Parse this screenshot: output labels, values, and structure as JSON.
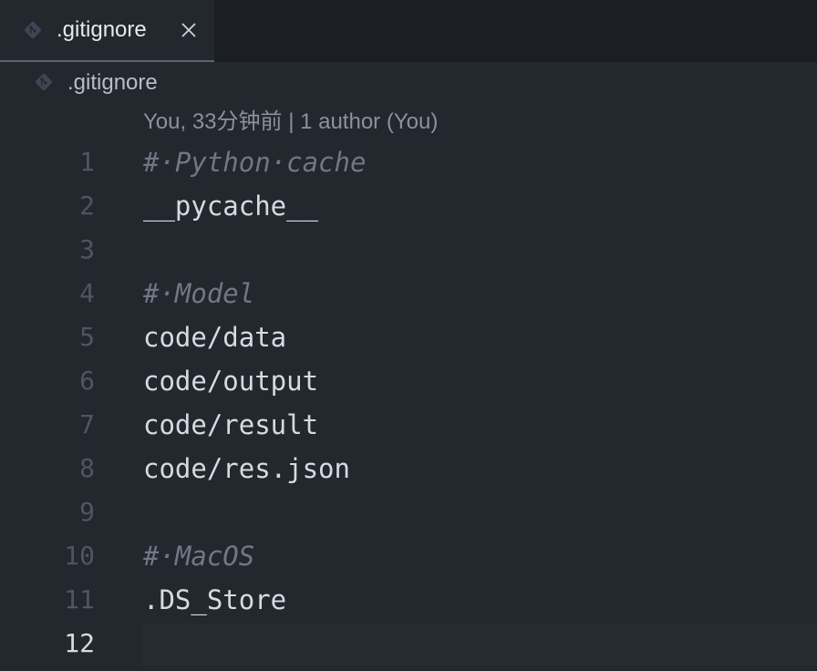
{
  "tab": {
    "label": ".gitignore",
    "icon": "git-diamond-icon",
    "close_icon": "close-icon",
    "close_symbol": "✕"
  },
  "breadcrumb": {
    "label": ".gitignore",
    "icon": "git-diamond-icon"
  },
  "blame": {
    "text": "You, 33分钟前 | 1 author (You)"
  },
  "editor": {
    "active_line": 12,
    "lines": [
      {
        "number": "1",
        "text": "#·Python·cache",
        "kind": "comment"
      },
      {
        "number": "2",
        "text": "__pycache__",
        "kind": "code"
      },
      {
        "number": "3",
        "text": "",
        "kind": "code"
      },
      {
        "number": "4",
        "text": "#·Model",
        "kind": "comment"
      },
      {
        "number": "5",
        "text": "code/data",
        "kind": "code"
      },
      {
        "number": "6",
        "text": "code/output",
        "kind": "code"
      },
      {
        "number": "7",
        "text": "code/result",
        "kind": "code"
      },
      {
        "number": "8",
        "text": "code/res.json",
        "kind": "code"
      },
      {
        "number": "9",
        "text": "",
        "kind": "code"
      },
      {
        "number": "10",
        "text": "#·MacOS",
        "kind": "comment"
      },
      {
        "number": "11",
        "text": ".DS_Store",
        "kind": "code"
      },
      {
        "number": "12",
        "text": "",
        "kind": "code"
      }
    ]
  },
  "colors": {
    "background": "#23272e",
    "tabbar": "#1b1f24",
    "git_icon": "#3c4654",
    "comment": "#6f7885",
    "text": "#d6dbe2"
  }
}
